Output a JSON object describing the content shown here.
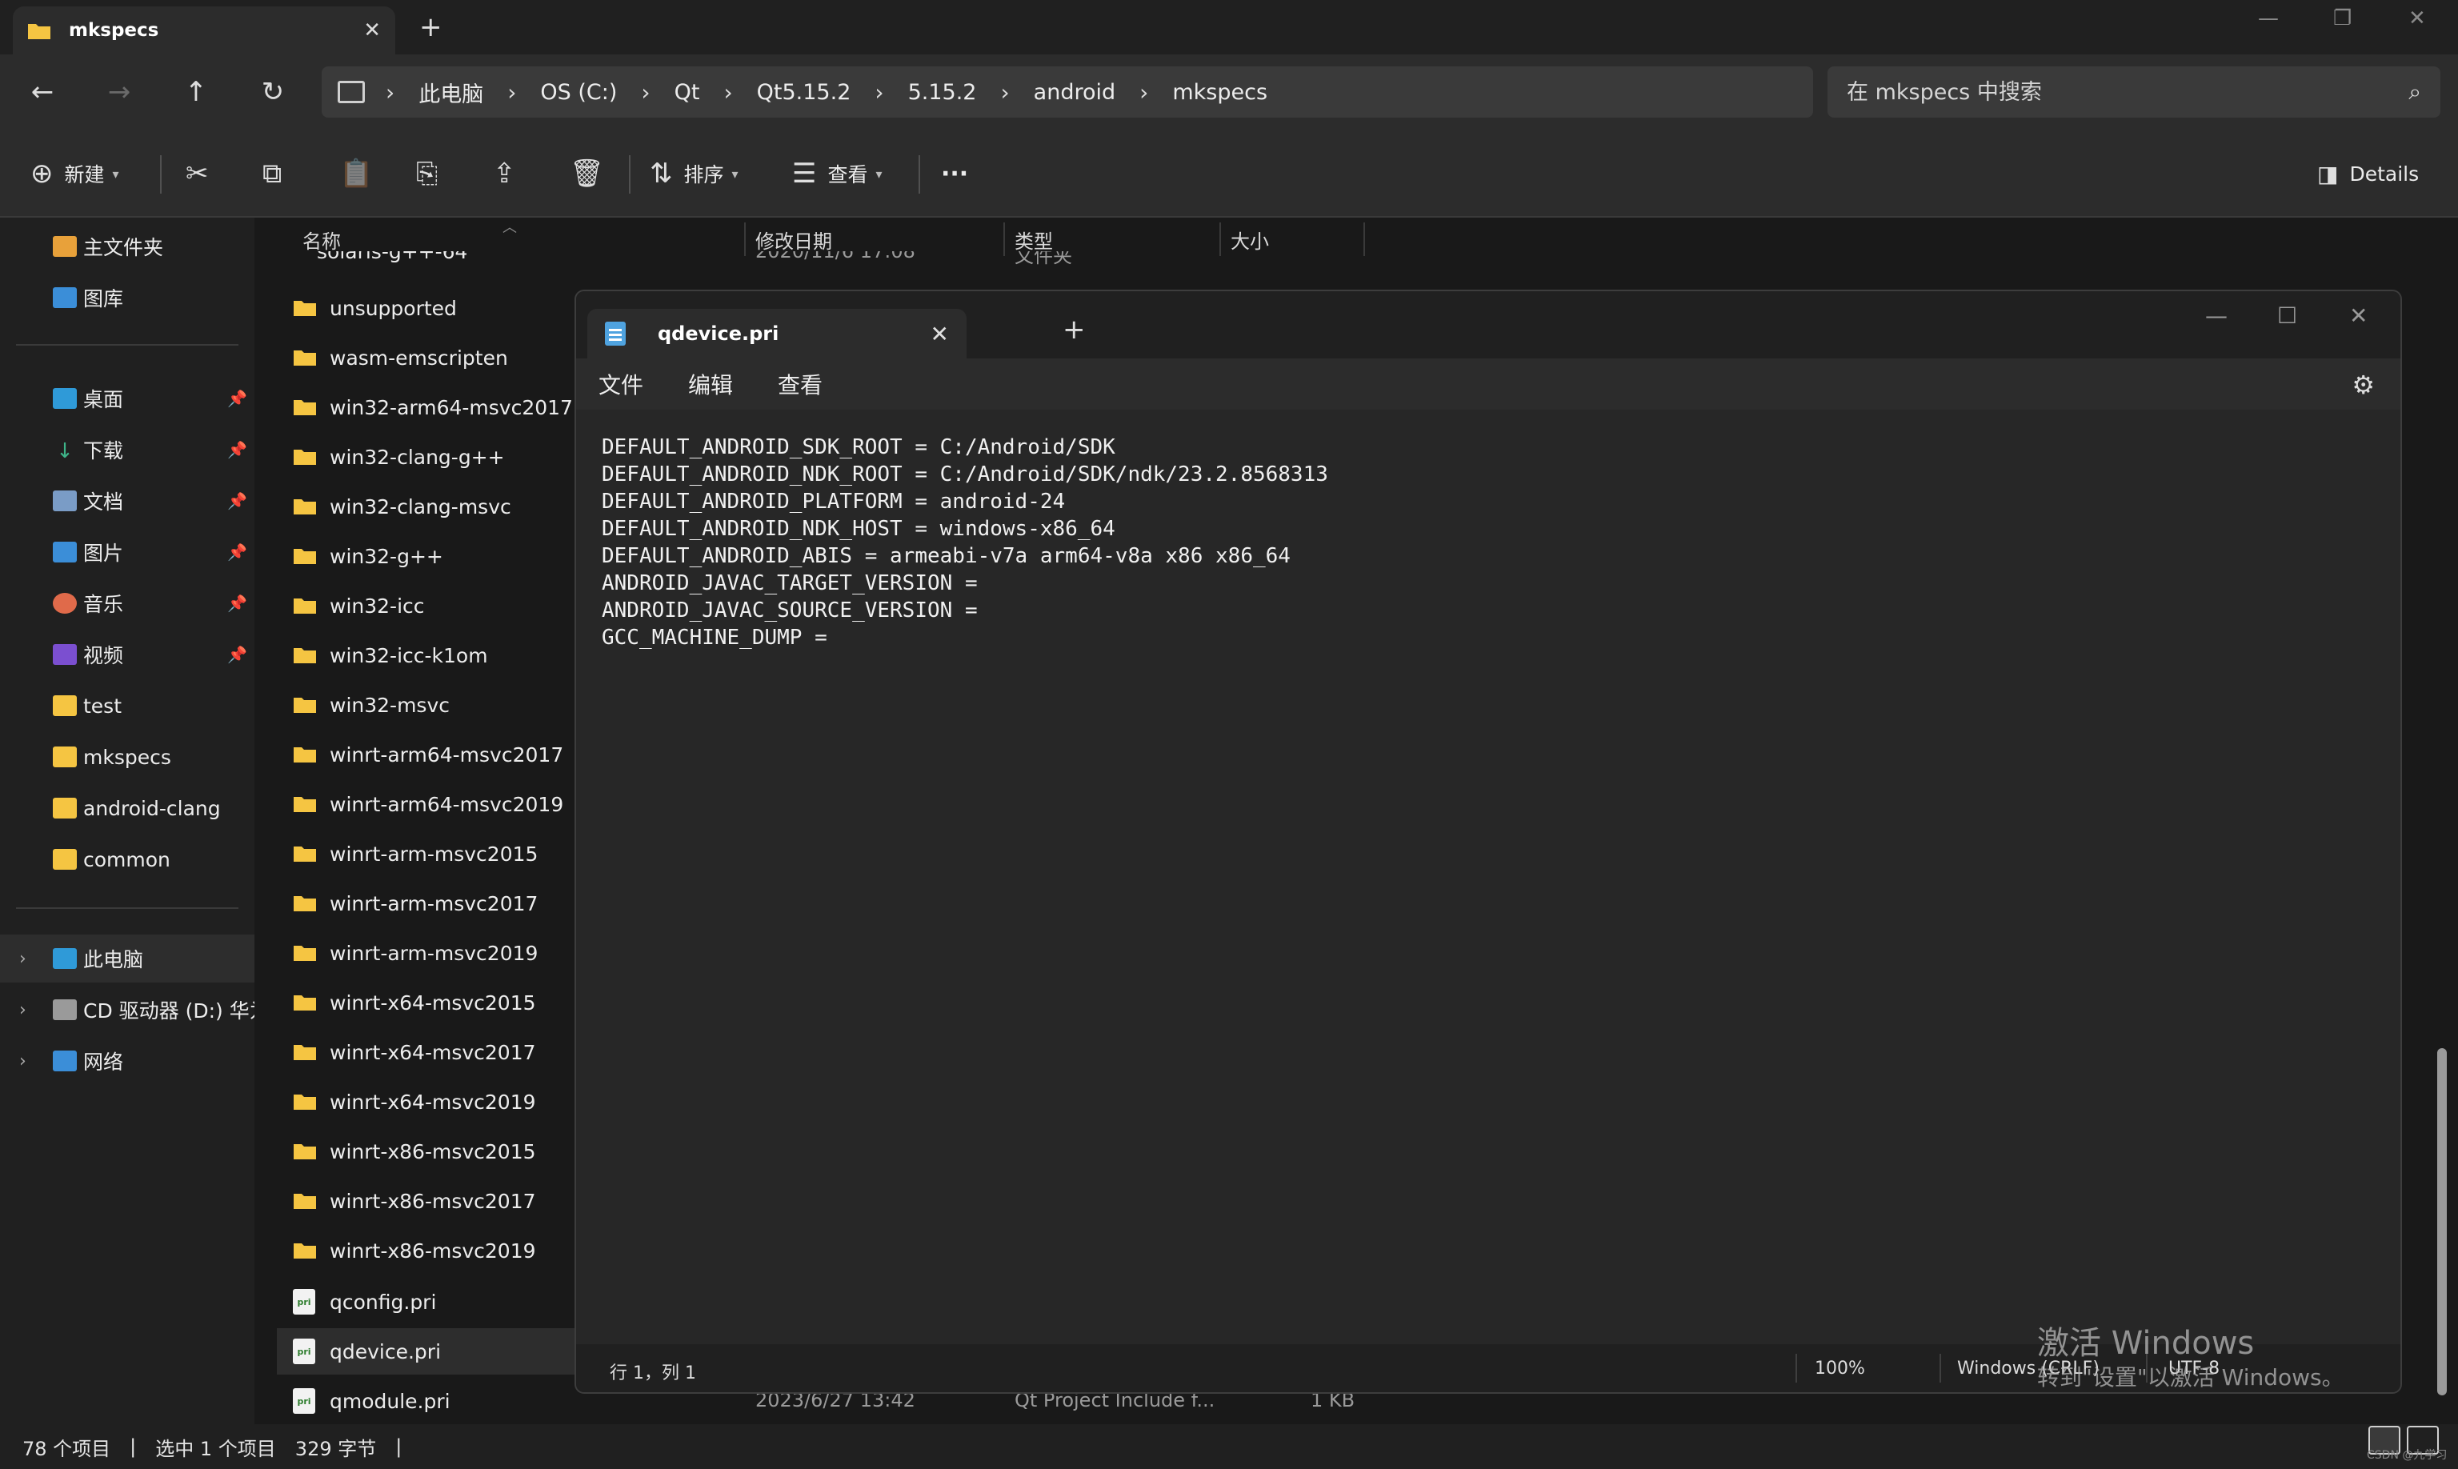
{
  "explorer": {
    "tab_title": "mkspecs",
    "breadcrumb": [
      "此电脑",
      "OS (C:)",
      "Qt",
      "Qt5.15.2",
      "5.15.2",
      "android",
      "mkspecs"
    ],
    "search_placeholder": "在 mkspecs 中搜索",
    "commands": {
      "new": "新建",
      "sort": "排序",
      "view": "查看",
      "more": "···",
      "details": "Details"
    },
    "sidebar": {
      "top": [
        {
          "label": "主文件夹",
          "icon": "home-icon"
        },
        {
          "label": "图库",
          "icon": "gallery-icon"
        }
      ],
      "quick": [
        {
          "label": "桌面",
          "icon": "desktop-icon"
        },
        {
          "label": "下载",
          "icon": "download-icon"
        },
        {
          "label": "文档",
          "icon": "document-icon"
        },
        {
          "label": "图片",
          "icon": "pictures-icon"
        },
        {
          "label": "音乐",
          "icon": "music-icon"
        },
        {
          "label": "视频",
          "icon": "video-icon"
        },
        {
          "label": "test",
          "icon": "folder-icon"
        },
        {
          "label": "mkspecs",
          "icon": "folder-icon"
        },
        {
          "label": "android-clang",
          "icon": "folder-icon"
        },
        {
          "label": "common",
          "icon": "folder-icon"
        }
      ],
      "drives": [
        {
          "label": "此电脑",
          "icon": "computer-icon"
        },
        {
          "label": "CD 驱动器 (D:) 华为",
          "icon": "cd-drive-icon"
        },
        {
          "label": "网络",
          "icon": "network-icon"
        }
      ]
    },
    "columns": {
      "name": "名称",
      "modified": "修改日期",
      "type": "类型",
      "size": "大小"
    },
    "partial_row": {
      "name": "solaris-g++-64",
      "modified": "2020/11/6 17:08",
      "type": "文件夹"
    },
    "folders": [
      "unsupported",
      "wasm-emscripten",
      "win32-arm64-msvc2017",
      "win32-clang-g++",
      "win32-clang-msvc",
      "win32-g++",
      "win32-icc",
      "win32-icc-k1om",
      "win32-msvc",
      "winrt-arm64-msvc2017",
      "winrt-arm64-msvc2019",
      "winrt-arm-msvc2015",
      "winrt-arm-msvc2017",
      "winrt-arm-msvc2019",
      "winrt-x64-msvc2015",
      "winrt-x64-msvc2017",
      "winrt-x64-msvc2019",
      "winrt-x86-msvc2015",
      "winrt-x86-msvc2017",
      "winrt-x86-msvc2019"
    ],
    "files": [
      "qconfig.pri",
      "qdevice.pri",
      "qmodule.pri"
    ],
    "last_file_meta": {
      "modified": "2023/6/27 13:42",
      "type": "Qt Project Include f...",
      "size": "1 KB"
    },
    "status": {
      "count": "78 个项目",
      "selected": "选中 1 个项目",
      "bytes": "329 字节"
    }
  },
  "notepad": {
    "tab_title": "qdevice.pri",
    "menu": [
      "文件",
      "编辑",
      "查看"
    ],
    "lines": [
      "DEFAULT_ANDROID_SDK_ROOT = C:/Android/SDK",
      "DEFAULT_ANDROID_NDK_ROOT = C:/Android/SDK/ndk/23.2.8568313",
      "DEFAULT_ANDROID_PLATFORM = android-24",
      "DEFAULT_ANDROID_NDK_HOST = windows-x86_64",
      "DEFAULT_ANDROID_ABIS = armeabi-v7a arm64-v8a x86 x86_64",
      "ANDROID_JAVAC_TARGET_VERSION =",
      "ANDROID_JAVAC_SOURCE_VERSION =",
      "GCC_MACHINE_DUMP ="
    ],
    "status": {
      "position": "行 1，列 1",
      "zoom": "100%",
      "line_ending": "Windows (CRLF)",
      "encoding": "UTF-8"
    }
  },
  "watermark": {
    "line1": "激活 Windows",
    "line2": "转到\"设置\"以激活 Windows。"
  },
  "csdn": "CSDN @九学习"
}
